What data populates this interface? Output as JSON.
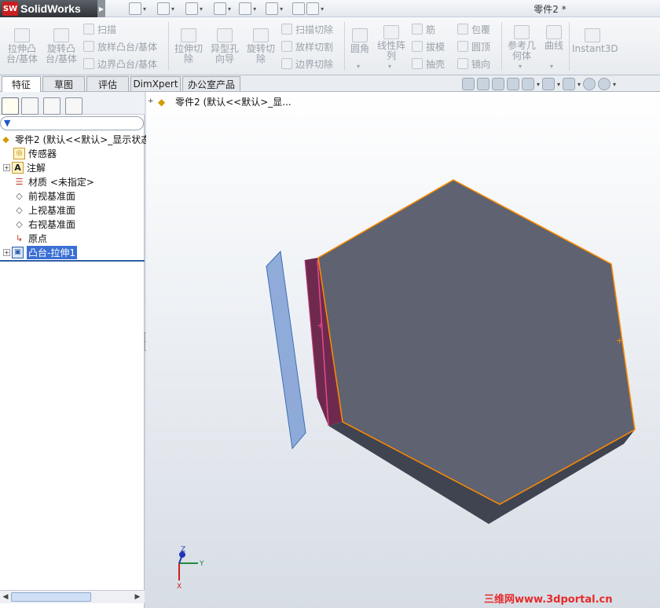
{
  "app": {
    "logo_mark": "SW",
    "name": "SolidWorks",
    "document_title": "零件2 *"
  },
  "ribbon": {
    "buttons": {
      "extrude_boss": "拉伸凸\n台/基体",
      "revolve_boss": "旋转凸\n台/基体",
      "extrude_cut": "拉伸切\n除",
      "hole_wizard": "异型孔\n向导",
      "revolve_cut": "旋转切\n除",
      "fillet": "圆角",
      "linear_pattern": "线性阵\n列",
      "ref_geometry": "参考几\n何体",
      "curves": "曲线",
      "instant3d": "Instant3D"
    },
    "small": {
      "sweep": "扫描",
      "loft": "放样凸台/基体",
      "boundary": "边界凸台/基体",
      "swept_cut": "扫描切除",
      "lofted_cut": "放样切割",
      "boundary_cut": "边界切除",
      "rib": "筋",
      "draft": "拔模",
      "shell": "抽壳",
      "wrap": "包覆",
      "dome": "圆顶",
      "mirror": "镜向"
    }
  },
  "tabs": [
    "特征",
    "草图",
    "评估",
    "DimXpert",
    "办公室产品"
  ],
  "tree": {
    "root": "零件2  (默认<<默认>_显示状态",
    "items": [
      "传感器",
      "注解",
      "材质 <未指定>",
      "前视基准面",
      "上视基准面",
      "右视基准面",
      "原点",
      "凸台-拉伸1"
    ]
  },
  "viewport": {
    "tree_label": "零件2  (默认<<默认>_显...",
    "triad": {
      "x": "X",
      "y": "Y",
      "z": "Z"
    }
  },
  "watermark": "三维网www.3dportal.cn",
  "colors": {
    "face": "#606470",
    "edge_highlight": "#ff8c00",
    "side_pink": "#e8488f",
    "plane_blue": "#6f8fc7"
  }
}
